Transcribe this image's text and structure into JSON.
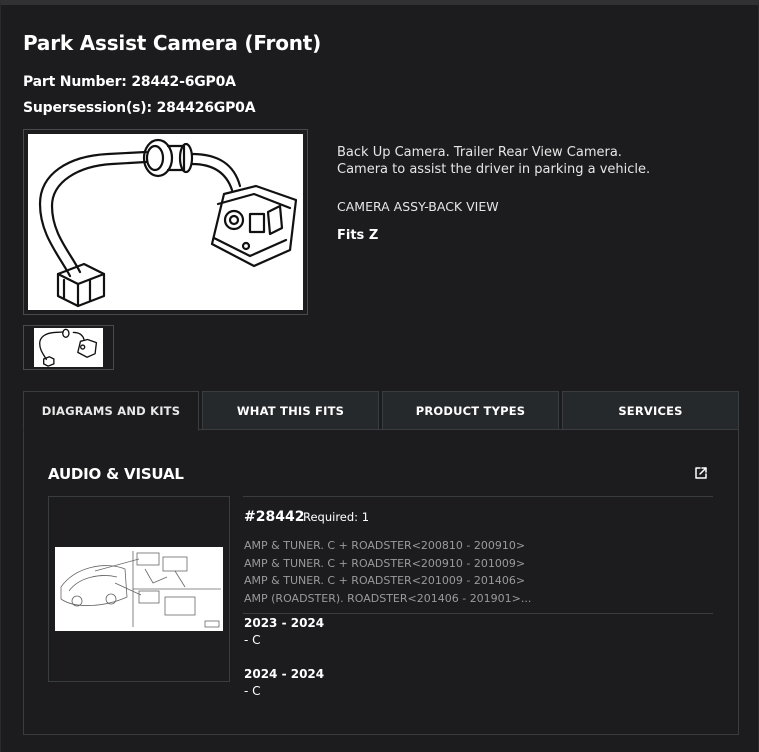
{
  "product": {
    "title": "Park Assist Camera (Front)",
    "part_number_label": "Part Number: ",
    "part_number": "28442-6GP0A",
    "supersession_label": "Supersession(s): ",
    "supersession": "284426GP0A"
  },
  "description": {
    "line1": "Back Up Camera. Trailer Rear View Camera.",
    "line2": "Camera to assist the driver in parking a vehicle.",
    "view": "CAMERA ASSY-BACK VIEW",
    "fits": "Fits Z"
  },
  "tabs": [
    {
      "label": "DIAGRAMS AND KITS",
      "active": true
    },
    {
      "label": "WHAT THIS FITS",
      "active": false
    },
    {
      "label": "PRODUCT TYPES",
      "active": false
    },
    {
      "label": "SERVICES",
      "active": false
    }
  ],
  "panel": {
    "section_title": "AUDIO & VISUAL",
    "ref_number": "#28442",
    "required": "Required: 1",
    "applications": [
      "AMP & TUNER. C + ROADSTER<200810 - 200910>",
      "AMP & TUNER. C + ROADSTER<200910 - 201009>",
      "AMP & TUNER. C + ROADSTER<201009 - 201406>",
      "AMP (ROADSTER). ROADSTER<201406 - 201901>..."
    ],
    "fitments": [
      {
        "years": "2023 - 2024",
        "trim": "- C"
      },
      {
        "years": "2024 - 2024",
        "trim": "- C"
      }
    ]
  },
  "colors": {
    "background": "#1c1c1e",
    "tab_inactive": "#26292c",
    "border": "#3a3d40",
    "muted_text": "#9a9a9c"
  },
  "icons": {
    "external_link": "external-link-icon"
  }
}
